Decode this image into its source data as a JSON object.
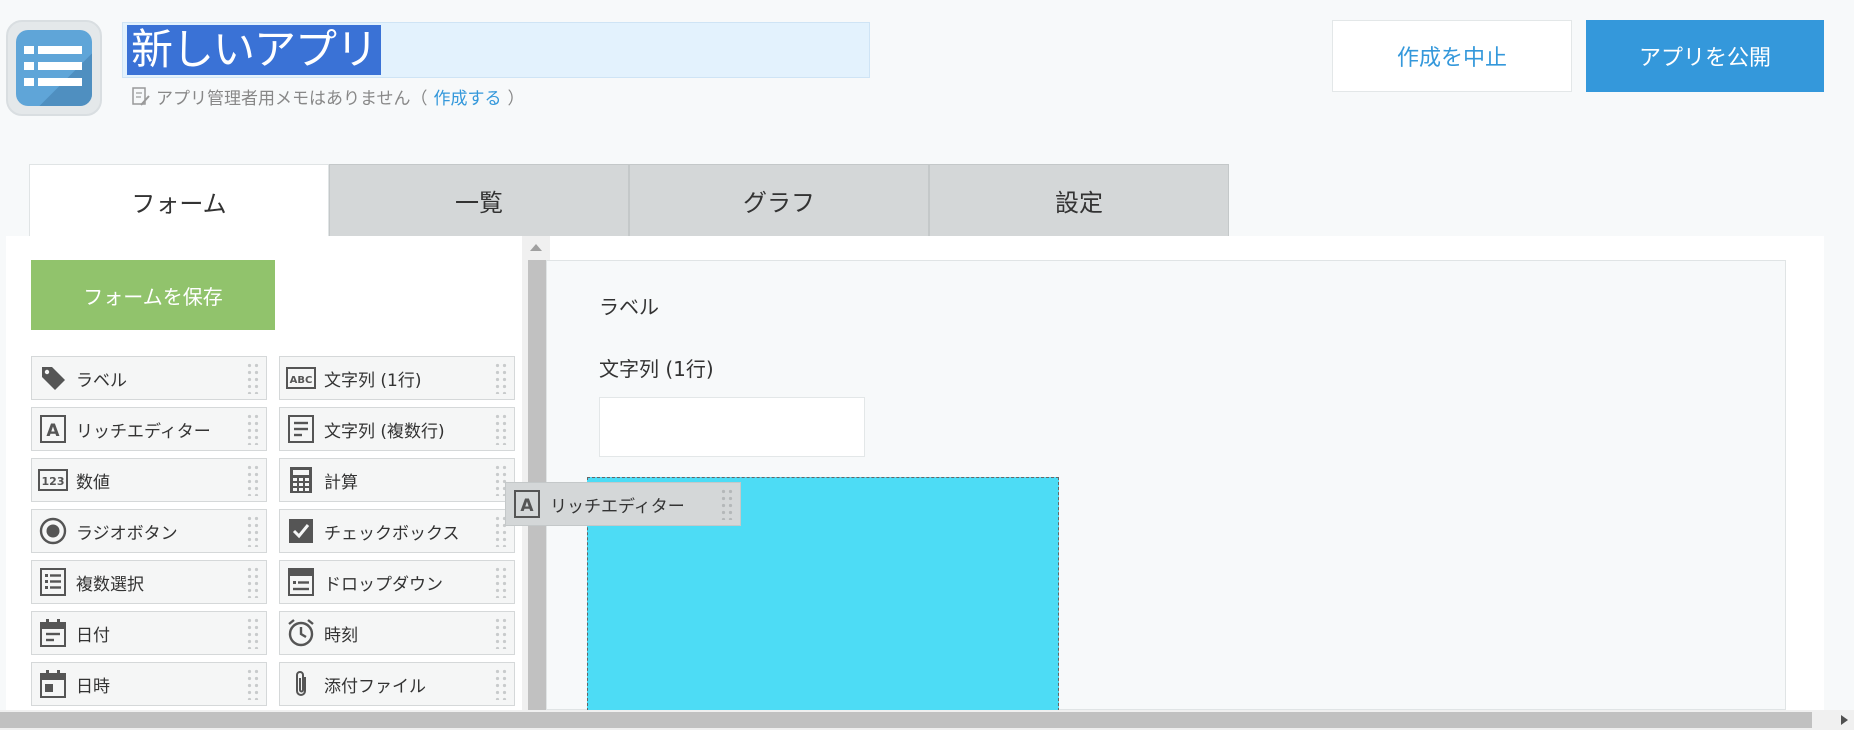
{
  "header": {
    "app_title": "新しいアプリ",
    "memo_text": "アプリ管理者用メモはありません（",
    "memo_link": "作成する",
    "memo_close": "）",
    "cancel_label": "作成を中止",
    "publish_label": "アプリを公開"
  },
  "tabs": [
    {
      "label": "フォーム",
      "active": true
    },
    {
      "label": "一覧",
      "active": false
    },
    {
      "label": "グラフ",
      "active": false
    },
    {
      "label": "設定",
      "active": false
    }
  ],
  "sidebar": {
    "save_label": "フォームを保存",
    "fields": [
      {
        "label": "ラベル",
        "icon": "tag-icon"
      },
      {
        "label": "文字列 (1行)",
        "icon": "abc-icon"
      },
      {
        "label": "リッチエディター",
        "icon": "rich-text-icon"
      },
      {
        "label": "文字列 (複数行)",
        "icon": "multiline-text-icon"
      },
      {
        "label": "数値",
        "icon": "number-icon"
      },
      {
        "label": "計算",
        "icon": "calculator-icon"
      },
      {
        "label": "ラジオボタン",
        "icon": "radio-icon"
      },
      {
        "label": "チェックボックス",
        "icon": "checkbox-icon"
      },
      {
        "label": "複数選択",
        "icon": "multi-select-icon"
      },
      {
        "label": "ドロップダウン",
        "icon": "dropdown-icon"
      },
      {
        "label": "日付",
        "icon": "calendar-icon"
      },
      {
        "label": "時刻",
        "icon": "clock-icon"
      },
      {
        "label": "日時",
        "icon": "datetime-icon"
      },
      {
        "label": "添付ファイル",
        "icon": "paperclip-icon"
      }
    ]
  },
  "canvas": {
    "label_field": "ラベル",
    "text_field_label": "文字列 (1行)",
    "text_field_value": "",
    "dragging_item": "リッチエディター"
  },
  "colors": {
    "accent": "#3498db",
    "save_green": "#91c36c",
    "drop_zone": "#4ddcf5",
    "title_selection": "#3a72d6"
  }
}
